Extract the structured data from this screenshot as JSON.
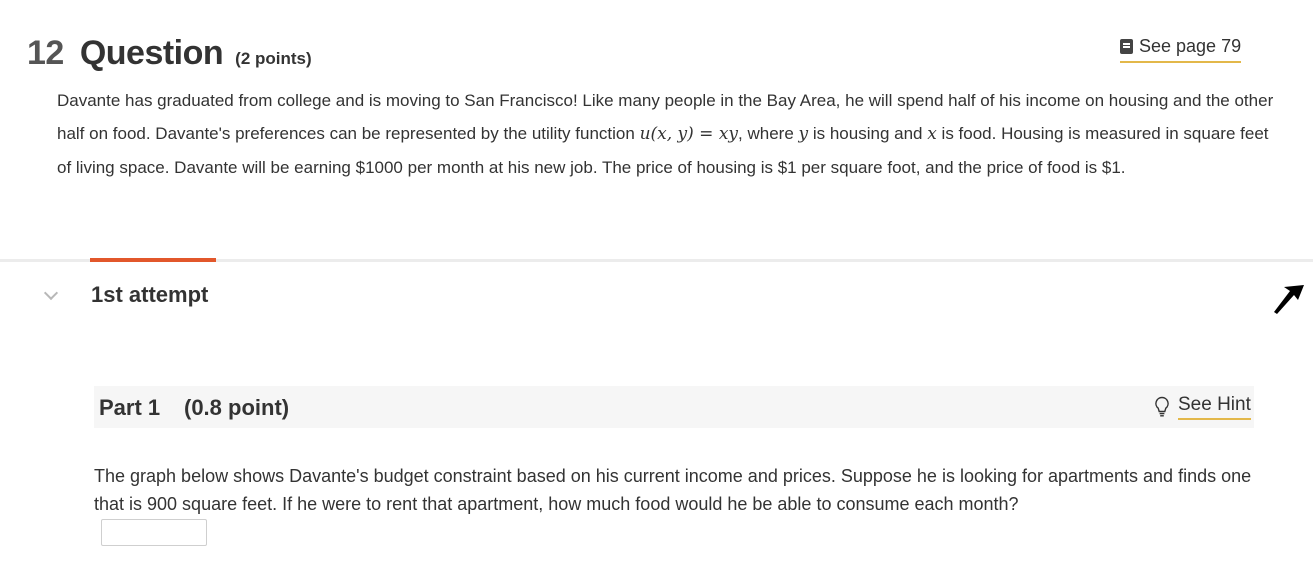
{
  "question": {
    "number": "12",
    "word": "Question",
    "points": "(2 points)",
    "see_page": "See page 79",
    "body": {
      "p1": "Davante has graduated from college and is moving to San Francisco! Like many people in the Bay Area, he will spend half of his income on housing and the other half on food. Davante's preferences can be represented by the utility function ",
      "utility_fn": "u(x, y) = xy",
      "p2": ", where ",
      "var_y": "y",
      "p3": " is housing and ",
      "var_x": "x",
      "p4": " is food. Housing is measured in square feet of living space. Davante will be earning $1000 per month at his new job. The price of housing is $1 per square foot, and the price of food is $1."
    }
  },
  "attempt": {
    "label": "1st attempt",
    "accent_color": "#e2572b"
  },
  "part": {
    "title": "Part 1",
    "points": "(0.8 point)",
    "see_hint": "See Hint",
    "text": "The graph below shows Davante's budget constraint based on his current income and prices. Suppose he is looking for apartments and finds one that is 900 square feet. If he were to rent that apartment, how much food would he be able to consume each month?",
    "answer_value": ""
  },
  "icons": {
    "book": "book-icon",
    "chevron": "chevron-down-icon",
    "bulb": "lightbulb-icon",
    "cursor": "mouse-pointer-icon"
  }
}
